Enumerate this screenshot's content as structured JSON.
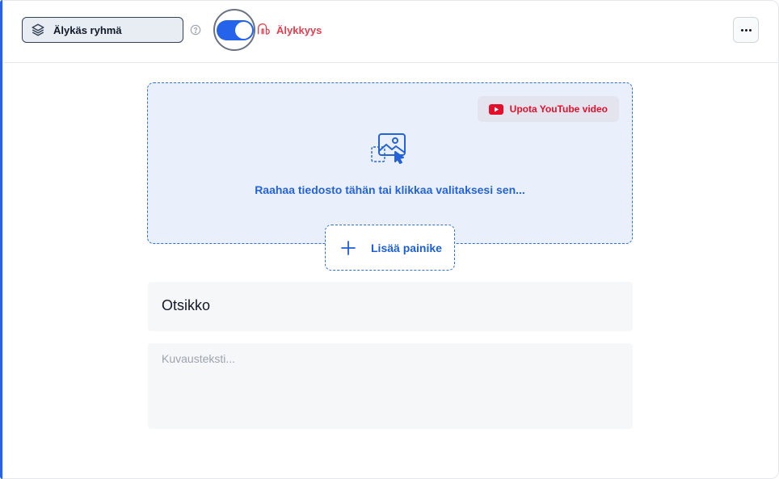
{
  "header": {
    "group_button_label": "Älykäs ryhmä",
    "toggle_state": "on",
    "smart_label": "Älykkyys"
  },
  "upload": {
    "youtube_button_label": "Upota YouTube video",
    "drop_text": "Raahaa tiedosto tähän tai klikkaa valitaksesi sen...",
    "add_button_label": "Lisää painike"
  },
  "form": {
    "title_value": "Otsikko",
    "description_placeholder": "Kuvausteksti..."
  },
  "colors": {
    "accent": "#2563eb",
    "smart_red": "#e0404f",
    "youtube_red": "#e4102b"
  },
  "icons": [
    "layers-icon",
    "help-icon",
    "smart-cloud-icon",
    "more-icon",
    "youtube-icon",
    "image-upload-icon",
    "plus-icon"
  ]
}
